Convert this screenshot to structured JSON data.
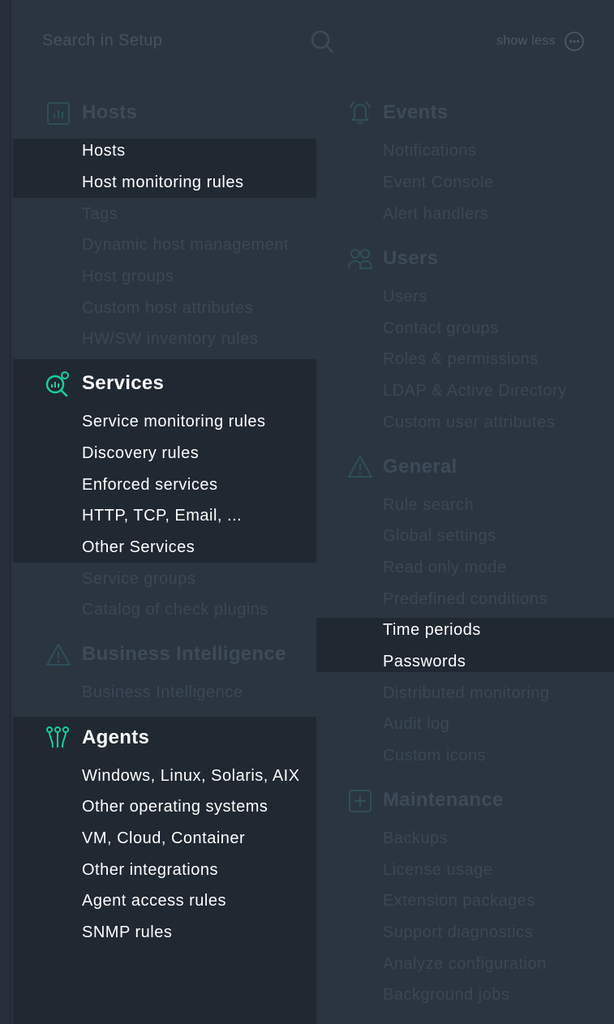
{
  "search": {
    "placeholder": "Search in Setup"
  },
  "toggle": {
    "label": "show less",
    "icon": "more-horizontal-icon"
  },
  "colors": {
    "background": "#2b3540",
    "highlight": "#202832",
    "accent": "#15d1a0",
    "dim_text": "#3a4755"
  },
  "left": {
    "hosts": {
      "title": "Hosts",
      "icon": "bar-chart-icon",
      "items": [
        "Hosts",
        "Host monitoring rules",
        "Tags",
        "Dynamic host management",
        "Host groups",
        "Custom host attributes",
        "HW/SW inventory rules"
      ]
    },
    "services": {
      "title": "Services",
      "icon": "service-search-icon",
      "items": [
        "Service monitoring rules",
        "Discovery rules",
        "Enforced services",
        "HTTP, TCP, Email, ...",
        "Other Services",
        "Service groups",
        "Catalog of check plugins"
      ]
    },
    "bi": {
      "title": "Business Intelligence",
      "icon": "warning-triangle-icon",
      "items": [
        "Business Intelligence"
      ]
    },
    "agents": {
      "title": "Agents",
      "icon": "agent-antenna-icon",
      "items": [
        "Windows, Linux, Solaris, AIX",
        "Other operating systems",
        "VM, Cloud, Container",
        "Other integrations",
        "Agent access rules",
        "SNMP rules"
      ]
    }
  },
  "right": {
    "events": {
      "title": "Events",
      "icon": "bell-icon",
      "items": [
        "Notifications",
        "Event Console",
        "Alert handlers"
      ]
    },
    "users": {
      "title": "Users",
      "icon": "users-icon",
      "items": [
        "Users",
        "Contact groups",
        "Roles & permissions",
        "LDAP & Active Directory",
        "Custom user attributes"
      ]
    },
    "general": {
      "title": "General",
      "icon": "warning-triangle-icon",
      "items": [
        "Rule search",
        "Global settings",
        "Read only mode",
        "Predefined conditions",
        "Time periods",
        "Passwords",
        "Distributed monitoring",
        "Audit log",
        "Custom icons"
      ]
    },
    "maintenance": {
      "title": "Maintenance",
      "icon": "plus-square-icon",
      "items": [
        "Backups",
        "License usage",
        "Extension packages",
        "Support diagnostics",
        "Analyze configuration",
        "Background jobs"
      ]
    }
  }
}
